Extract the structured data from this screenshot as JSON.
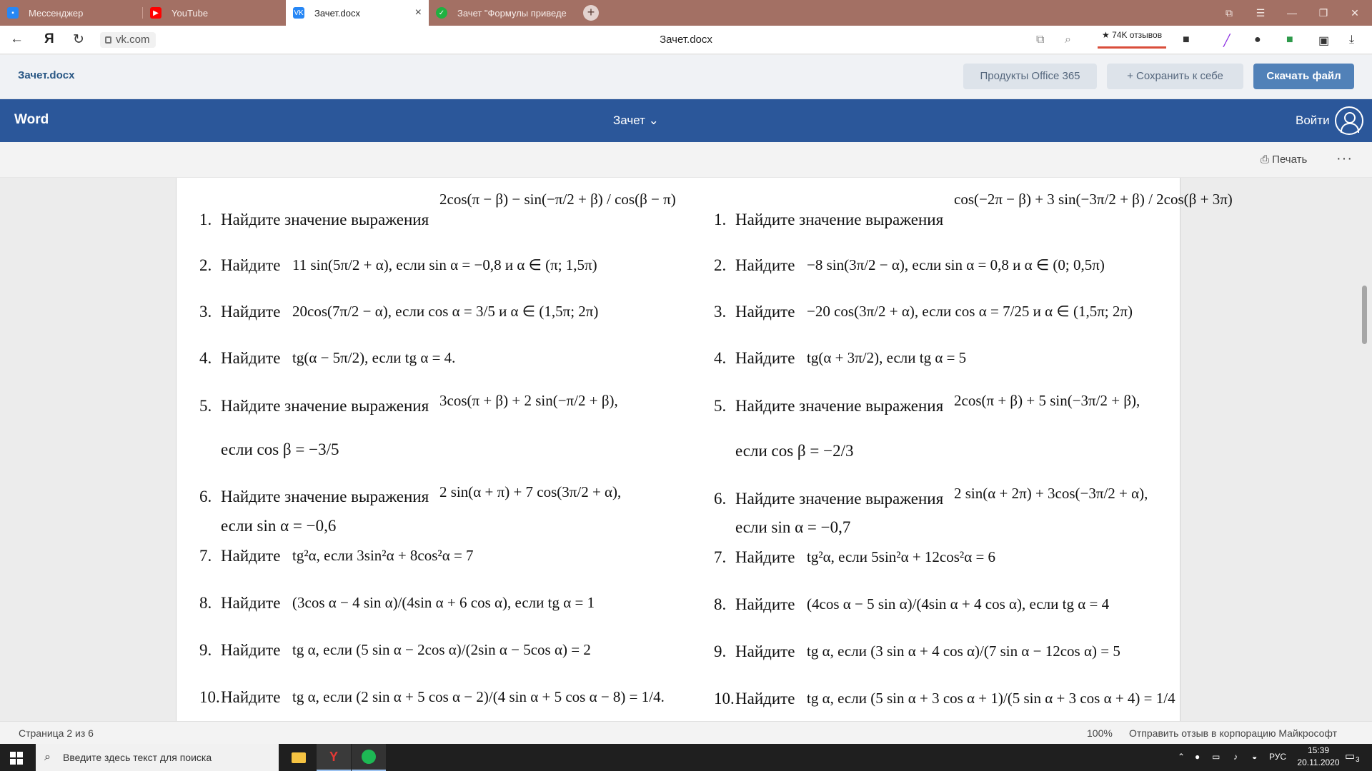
{
  "browser": {
    "tabs": [
      {
        "label": "Мессенджер",
        "icon": "chat-icon",
        "color": "#2787f5"
      },
      {
        "label": "YouTube",
        "icon": "youtube-icon",
        "color": "#ff0000"
      },
      {
        "label": "Зачет.docx",
        "icon": "vk-icon",
        "color": "#2787f5"
      },
      {
        "label": "Зачет \"Формулы приведе",
        "icon": "check-icon",
        "color": "#1fb141"
      }
    ],
    "url": "vk.com",
    "page_title": "Зачет.docx",
    "reviews": "★ 74K отзывов"
  },
  "vk": {
    "filename": "Зачет.docx",
    "office_btn": "Продукты Office 365",
    "save_btn": "+ Сохранить к себе",
    "download_btn": "Скачать файл"
  },
  "word": {
    "app": "Word",
    "doc_title": "Зачет ⌄",
    "signin": "Войти",
    "print": "Печать",
    "more": "···"
  },
  "doc": {
    "left": [
      {
        "n": "1.",
        "label": "Найдите значение выражения",
        "expr": "2cos(π − β) − sin(−π/2 + β) / cos(β − π)"
      },
      {
        "n": "2.",
        "label": "Найдите",
        "expr": "11 sin(5π/2 + α), если sin α = −0,8 и α ∈ (π; 1,5π)"
      },
      {
        "n": "3.",
        "label": "Найдите",
        "expr": "20cos(7π/2 − α), если cos α = 3/5 и α ∈ (1,5π; 2π)"
      },
      {
        "n": "4.",
        "label": "Найдите",
        "expr": "tg(α − 5π/2), если tg α = 4."
      },
      {
        "n": "5.",
        "label": "Найдите значение выражения",
        "expr": "3cos(π + β) + 2 sin(−π/2 + β),",
        "sub": "если cos β = −3/5"
      },
      {
        "n": "6.",
        "label": "Найдите значение выражения",
        "expr": "2 sin(α + π) + 7 cos(3π/2 + α),",
        "sub": "если sin α = −0,6"
      },
      {
        "n": "7.",
        "label": "Найдите",
        "expr": "tg²α, если 3sin²α + 8cos²α = 7"
      },
      {
        "n": "8.",
        "label": "Найдите",
        "expr": "(3cos α − 4 sin α)/(4sin α + 6 cos α), если tg α = 1"
      },
      {
        "n": "9.",
        "label": "Найдите",
        "expr": "tg α, если (5 sin α − 2cos α)/(2sin α − 5cos α) = 2"
      },
      {
        "n": "10.",
        "label": "Найдите",
        "expr": "tg α, если (2 sin α + 5 cos α − 2)/(4 sin α + 5 cos α − 8) = 1/4."
      }
    ],
    "right": [
      {
        "n": "1.",
        "label": "Найдите значение выражения",
        "expr": "cos(−2π − β) + 3 sin(−3π/2 + β) / 2cos(β + 3π)"
      },
      {
        "n": "2.",
        "label": "Найдите",
        "expr": "−8 sin(3π/2 − α), если sin α = 0,8 и α ∈ (0; 0,5π)"
      },
      {
        "n": "3.",
        "label": "Найдите",
        "expr": "−20 cos(3π/2 + α), если cos α = 7/25 и α ∈ (1,5π; 2π)"
      },
      {
        "n": "4.",
        "label": "Найдите",
        "expr": "tg(α + 3π/2), если tg α = 5"
      },
      {
        "n": "5.",
        "label": "Найдите значение выражения",
        "expr": "2cos(π + β) + 5 sin(−3π/2 + β),",
        "sub": "если cos β = −2/3"
      },
      {
        "n": "6.",
        "label": "Найдите значение выражения",
        "expr": "2 sin(α + 2π) + 3cos(−3π/2 + α),",
        "sub": "если sin α = −0,7"
      },
      {
        "n": "7.",
        "label": "Найдите",
        "expr": "tg²α, если 5sin²α + 12cos²α = 6"
      },
      {
        "n": "8.",
        "label": "Найдите",
        "expr": "(4cos α − 5 sin α)/(4sin α + 4 cos α), если tg α = 4"
      },
      {
        "n": "9.",
        "label": "Найдите",
        "expr": "tg α, если (3 sin α + 4 cos α)/(7 sin α − 12cos α) = 5"
      },
      {
        "n": "10.",
        "label": "Найдите",
        "expr": "tg α, если (5 sin α + 3 cos α + 1)/(5 sin α + 3 cos α + 4) = 1/4"
      }
    ]
  },
  "status": {
    "page": "Страница 2 из 6",
    "zoom": "100%",
    "feedback": "Отправить отзыв в корпорацию Майкрософт"
  },
  "taskbar": {
    "search_placeholder": "Введите здесь текст для поиска",
    "lang": "РУС",
    "time": "15:39",
    "date": "20.11.2020",
    "notif_count": "3"
  }
}
